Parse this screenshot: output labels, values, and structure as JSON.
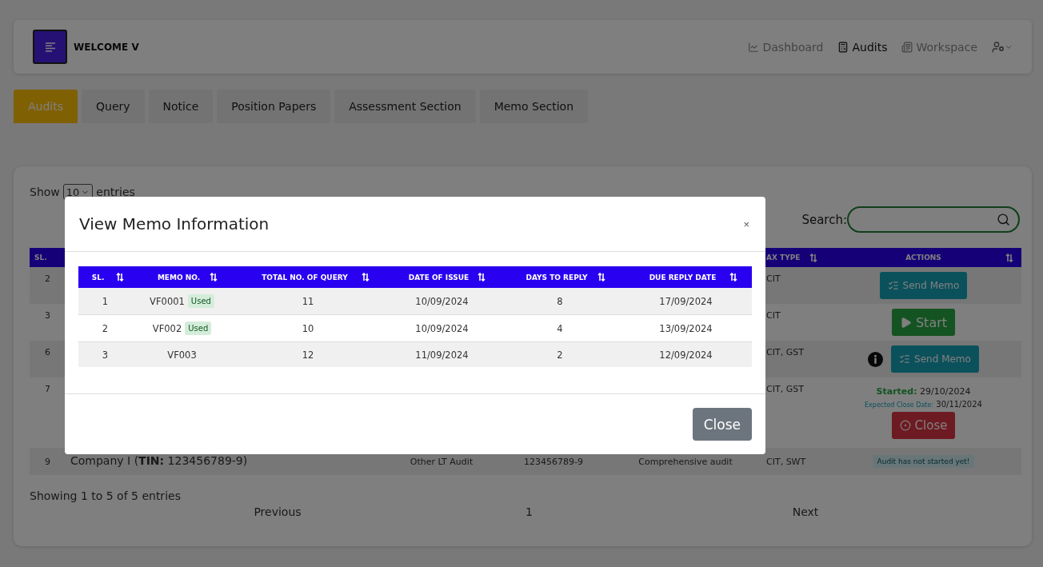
{
  "navbar": {
    "brand": "WELCOME V",
    "links": [
      {
        "label": "Dashboard",
        "kind": "dashboard",
        "selected": false
      },
      {
        "label": "Audits",
        "kind": "audits",
        "selected": true
      },
      {
        "label": "Workspace",
        "kind": "workspace",
        "selected": false
      }
    ]
  },
  "tabs": [
    {
      "label": "Audits",
      "selected": true
    },
    {
      "label": "Query",
      "selected": false
    },
    {
      "label": "Notice",
      "selected": false
    },
    {
      "label": "Position Papers",
      "selected": false
    },
    {
      "label": "Assessment Section",
      "selected": false
    },
    {
      "label": "Memo Section",
      "selected": false
    }
  ],
  "list": {
    "show_label": "Show",
    "page_size": "10",
    "entries_label": "entries",
    "search_label": "Search:",
    "columns": [
      {
        "label": "SL.",
        "sortable": false
      },
      {
        "label": "AX TYPE",
        "sortable": true
      },
      {
        "label": "ACTIONS",
        "sortable": true
      }
    ],
    "rows": [
      {
        "sl": "2",
        "tax_type": "CIT",
        "actions": [
          {
            "kind": "memo_button",
            "label": "Send Memo"
          }
        ]
      },
      {
        "sl": "3",
        "tax_type": "CIT",
        "actions": [
          {
            "kind": "start_button",
            "label": "Start"
          }
        ]
      },
      {
        "sl": "6",
        "tax_type": "CIT, GST",
        "actions": [
          {
            "kind": "info_icon"
          },
          {
            "kind": "memo_button",
            "label": "Send Memo"
          }
        ]
      },
      {
        "sl": "7",
        "tax_type": "CIT, GST",
        "actions": [
          {
            "kind": "started",
            "label": "Started:",
            "value": "29/10/2024"
          },
          {
            "kind": "expected",
            "label": "Expected Close Date:",
            "value": "30/11/2024"
          },
          {
            "kind": "close_button",
            "label": "Close"
          }
        ]
      },
      {
        "sl": "9",
        "name": "Company I (**TIN:** 123456789-9)",
        "audit_type": "Other LT Audit",
        "tin": "123456789-9",
        "scope": "Comprehensive audit",
        "tax_type": "CIT, SWT",
        "actions": [
          {
            "kind": "badge",
            "label": "Audit has not started yet!"
          }
        ]
      }
    ],
    "info": "Showing 1 to 5 of 5 entries",
    "pagination": {
      "previous": "Previous",
      "pages": [
        {
          "label": "1",
          "selected": true
        }
      ],
      "next": "Next"
    }
  },
  "modal": {
    "title": "View Memo Information",
    "close_icon": "×",
    "columns": [
      "SL.",
      "MEMO NO.",
      "TOTAL NO. OF QUERY",
      "DATE OF ISSUE",
      "DAYS TO REPLY",
      "DUE REPLY DATE"
    ],
    "rows": [
      {
        "sl": "1",
        "memo_no": "VF0001",
        "badge": "Used",
        "total_queries": "11",
        "date_of_issue": "10/09/2024",
        "days_to_reply": "8",
        "due_reply_date": "17/09/2024"
      },
      {
        "sl": "2",
        "memo_no": "VF002",
        "badge": "Used",
        "total_queries": "10",
        "date_of_issue": "10/09/2024",
        "days_to_reply": "4",
        "due_reply_date": "13/09/2024"
      },
      {
        "sl": "3",
        "memo_no": "VF003",
        "total_queries": "12",
        "date_of_issue": "11/09/2024",
        "days_to_reply": "2",
        "due_reply_date": "12/09/2024"
      }
    ],
    "footer_button": "Close"
  }
}
